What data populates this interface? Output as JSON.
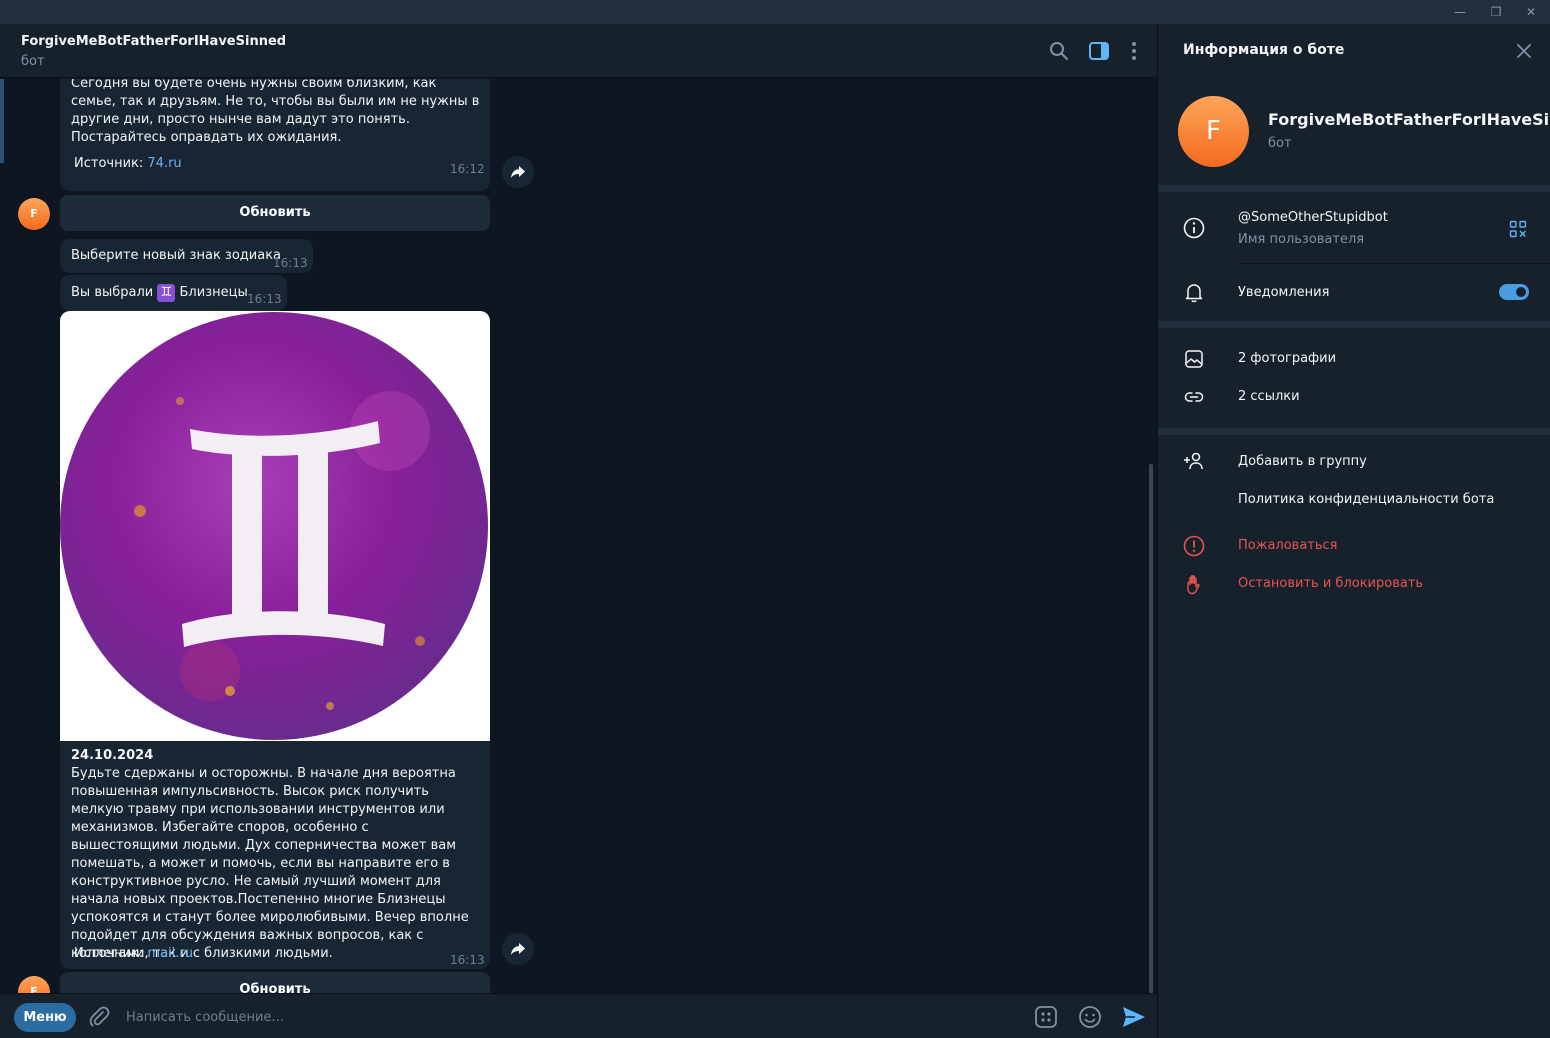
{
  "window": {
    "minimize": "—",
    "restore": "❐",
    "close": "✕"
  },
  "chat": {
    "title": "ForgiveMeBotFatherForIHaveSinned",
    "subtitle": "бот"
  },
  "messages": {
    "first": {
      "text": "Сегодня вы будете очень нужны своим близким, как семье, так и друзьям. Не то, чтобы вы были им не нужны в другие дни, просто нынче вам дадут это понять. Постарайтесь оправдать их ожидания.",
      "source_label": "Источник:",
      "source_link": "74.ru",
      "time": "16:12"
    },
    "refresh_button": "Обновить",
    "avatar_letter": "F",
    "choose": {
      "text": "Выберите новый знак зодиака",
      "time": "16:13"
    },
    "chosen": {
      "prefix": "Вы выбрали",
      "sign": "♊",
      "suffix": "Близнецы",
      "time": "16:13"
    },
    "horoscope": {
      "date": "24.10.2024",
      "text": "Будьте сдержаны и осторожны. В начале дня вероятна повышенная импульсивность. Высок риск получить мелкую травму при использовании инструментов или механизмов. Избегайте споров, особенно с вышестоящими людьми. Дух соперничества может вам помешать, а может и помочь, если вы направите его в конструктивное русло. Не самый лучший момент для начала новых проектов.Постепенно многие Близнецы успокоятся и станут более миролюбивыми. Вечер вполне подойдет для обсуждения важных вопросов, как с коллегами, так и с близкими людьми.",
      "source_label": "Источник:",
      "source_link": "mail.ru",
      "time": "16:13"
    }
  },
  "composer": {
    "menu": "Меню",
    "placeholder": "Написать сообщение..."
  },
  "panel": {
    "title": "Информация о боте",
    "avatar_letter": "F",
    "name": "ForgiveMeBotFatherForIHaveSin...",
    "status": "бот",
    "username": "@SomeOtherStupidbot",
    "username_label": "Имя пользователя",
    "notifications": "Уведомления",
    "notifications_on": true,
    "photos": "2 фотографии",
    "links": "2 ссылки",
    "add_to_group": "Добавить в группу",
    "privacy": "Политика конфиденциальности бота",
    "report": "Пожаловаться",
    "block": "Остановить и блокировать"
  },
  "colors": {
    "accent": "#6ab3f3",
    "danger": "#e5554f",
    "bubble": "#182533",
    "background": "#0e1621",
    "panel": "#17212b"
  }
}
